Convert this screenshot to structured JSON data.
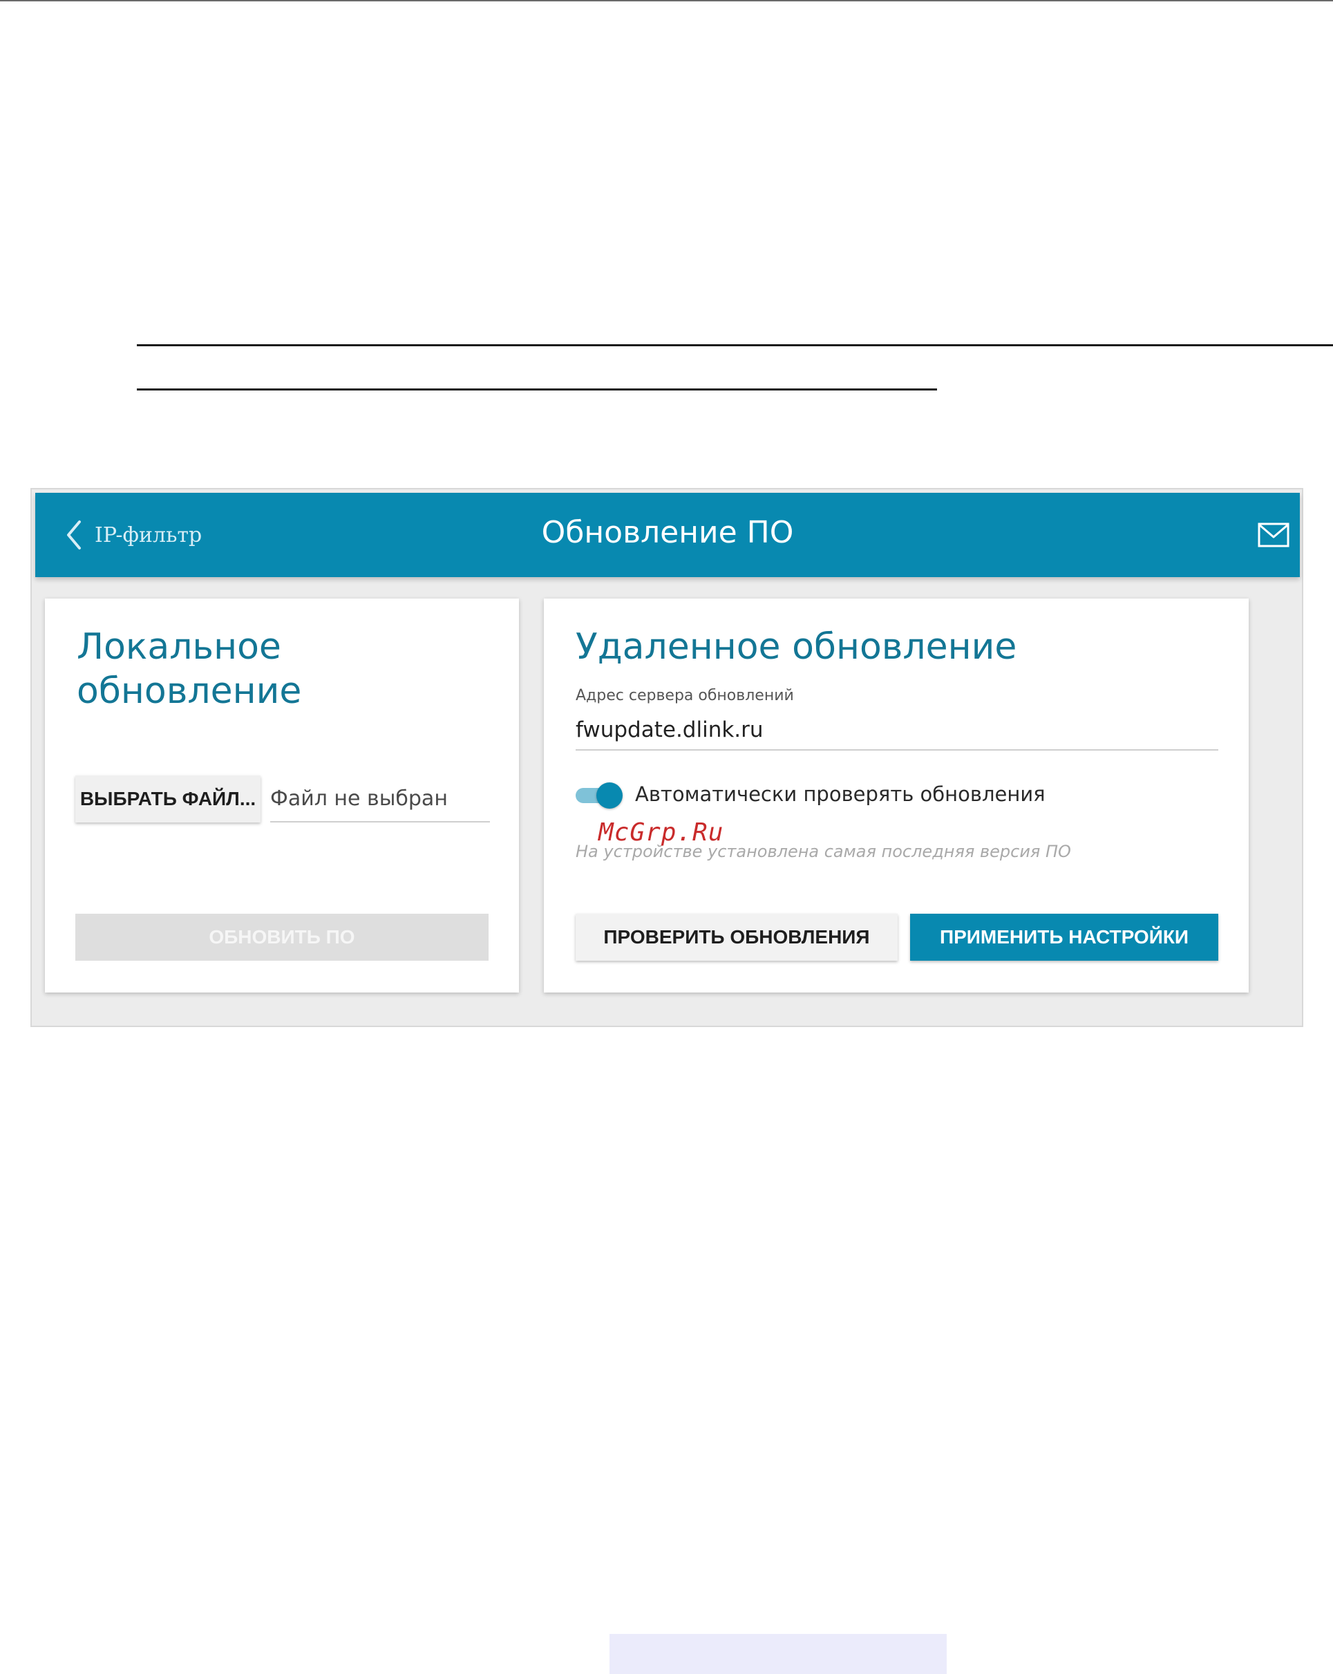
{
  "header": {
    "back_label": "IP-фильтр",
    "title": "Обновление ПО"
  },
  "local_update": {
    "title": "Локальное обновление",
    "choose_file_label": "ВЫБРАТЬ ФАЙЛ...",
    "file_status": "Файл не выбран",
    "update_button_label": "ОБНОВИТЬ ПО",
    "update_button_enabled": false
  },
  "remote_update": {
    "title": "Удаленное обновление",
    "server_label": "Адрес сервера обновлений",
    "server_value": "fwupdate.dlink.ru",
    "auto_check_label": "Автоматически проверять обновления",
    "auto_check_enabled": true,
    "status_text": "На устройстве установлена самая последняя версия ПО",
    "check_button_label": "ПРОВЕРИТЬ ОБНОВЛЕНИЯ",
    "apply_button_label": "ПРИМЕНИТЬ НАСТРОЙКИ"
  },
  "watermark": "McGrp.Ru",
  "colors": {
    "header_bg": "#0889b0",
    "title_text": "#137695",
    "primary_button": "#0889b0",
    "disabled_button": "#dedede",
    "watermark": "#c92b2b"
  },
  "icons": {
    "back": "chevron-left-icon",
    "mail": "envelope-icon"
  }
}
